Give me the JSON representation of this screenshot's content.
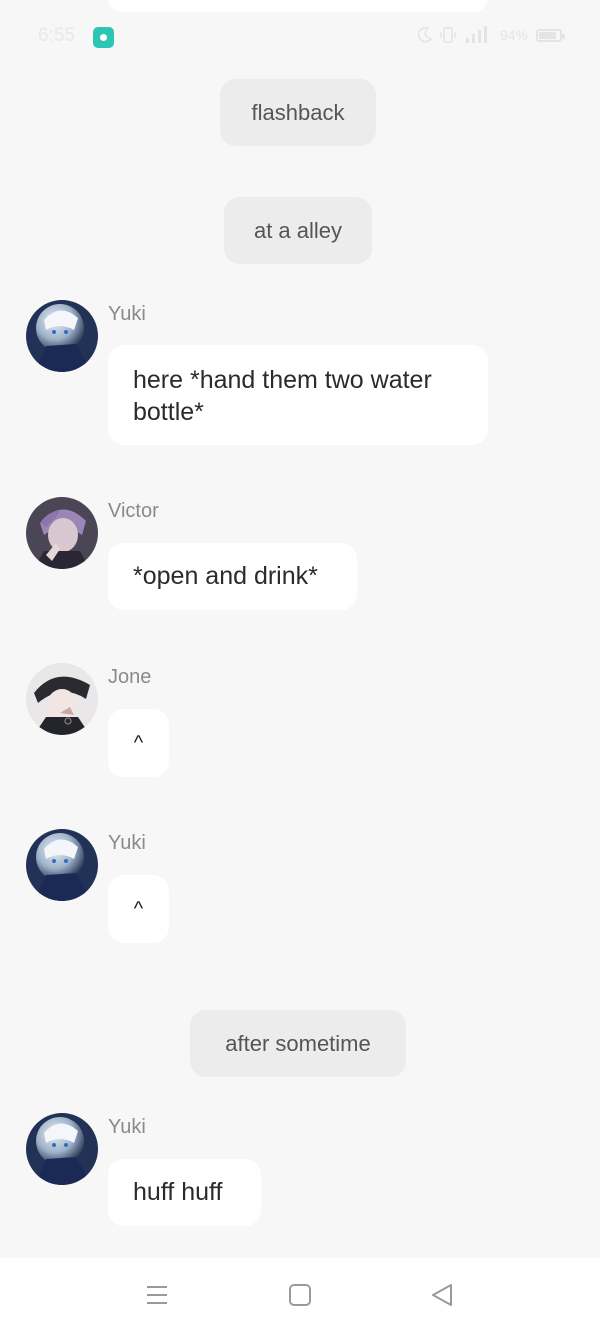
{
  "status_bar": {
    "time": "6:55",
    "battery_text": "94%"
  },
  "messages": {
    "system": [
      "flashback",
      "at a alley",
      "after sometime"
    ],
    "chat": [
      {
        "sender": "Yuki",
        "text": "here *hand them two water bottle*"
      },
      {
        "sender": "Victor",
        "text": "*open and drink*"
      },
      {
        "sender": "Jone",
        "text": "^"
      },
      {
        "sender": "Yuki",
        "text": "^"
      },
      {
        "sender": "Yuki",
        "text": "huff huff"
      }
    ]
  },
  "icons": {
    "app_badge": "app-notification-icon",
    "moon": "do-not-disturb-icon",
    "vibrate": "vibrate-icon",
    "signal": "signal-icon",
    "battery": "battery-icon",
    "menu": "menu-icon",
    "home": "home-icon",
    "back": "back-icon"
  },
  "colors": {
    "background": "#f7f7f7",
    "bubble": "#ffffff",
    "system_pill": "#ececec",
    "sender_name": "#8a8a8a",
    "app_badge": "#2ec4b6"
  }
}
